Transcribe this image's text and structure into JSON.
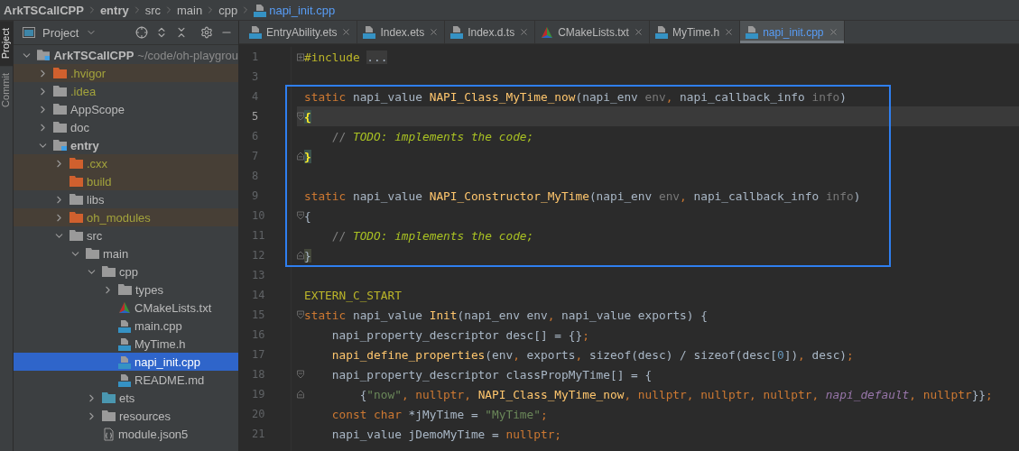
{
  "breadcrumbs": [
    {
      "label": "ArkTSCallCPP",
      "kind": "project"
    },
    {
      "label": "entry",
      "kind": "module"
    },
    {
      "label": "src",
      "kind": "dir"
    },
    {
      "label": "main",
      "kind": "dir"
    },
    {
      "label": "cpp",
      "kind": "dir"
    },
    {
      "label": "napi_init.cpp",
      "kind": "file"
    }
  ],
  "tool_strip": [
    {
      "label": "Project",
      "selected": true
    },
    {
      "label": "Commit",
      "selected": false
    }
  ],
  "project_panel": {
    "title": "Project",
    "tree": [
      {
        "label": "ArkTSCallCPP",
        "path": "~/code/oh-playgrou",
        "kind": "module",
        "expanded": true,
        "selected": false,
        "excluded": false,
        "ignored": false,
        "children": [
          {
            "label": ".hvigor",
            "kind": "folder",
            "expanded": false,
            "selected": false,
            "excluded": true,
            "ignored": true
          },
          {
            "label": ".idea",
            "kind": "folder",
            "expanded": false,
            "selected": false,
            "excluded": false,
            "ignored": true
          },
          {
            "label": "AppScope",
            "kind": "folder",
            "expanded": false,
            "selected": false,
            "excluded": false,
            "ignored": false
          },
          {
            "label": "doc",
            "kind": "folder",
            "expanded": false,
            "selected": false,
            "excluded": false,
            "ignored": false
          },
          {
            "label": "entry",
            "kind": "module",
            "expanded": true,
            "selected": false,
            "excluded": false,
            "ignored": false,
            "children": [
              {
                "label": ".cxx",
                "kind": "folder",
                "expanded": false,
                "selected": false,
                "excluded": true,
                "ignored": true
              },
              {
                "label": "build",
                "kind": "folder",
                "selected": false,
                "excluded": true,
                "ignored": true
              },
              {
                "label": "libs",
                "kind": "folder",
                "expanded": false,
                "selected": false,
                "excluded": false,
                "ignored": false
              },
              {
                "label": "oh_modules",
                "kind": "folder",
                "expanded": false,
                "selected": false,
                "excluded": true,
                "ignored": true
              },
              {
                "label": "src",
                "kind": "folder",
                "expanded": true,
                "selected": false,
                "excluded": false,
                "ignored": false,
                "children": [
                  {
                    "label": "main",
                    "kind": "folder",
                    "expanded": true,
                    "selected": false,
                    "excluded": false,
                    "ignored": false,
                    "children": [
                      {
                        "label": "cpp",
                        "kind": "folder",
                        "expanded": true,
                        "selected": false,
                        "excluded": false,
                        "ignored": false,
                        "children": [
                          {
                            "label": "types",
                            "kind": "folder",
                            "expanded": false,
                            "selected": false,
                            "excluded": false,
                            "ignored": false
                          },
                          {
                            "label": "CMakeLists.txt",
                            "kind": "cmake",
                            "selected": false,
                            "ignored": false
                          },
                          {
                            "label": "main.cpp",
                            "kind": "cpp",
                            "selected": false,
                            "ignored": false
                          },
                          {
                            "label": "MyTime.h",
                            "kind": "header",
                            "selected": false,
                            "ignored": false
                          },
                          {
                            "label": "napi_init.cpp",
                            "kind": "cpp",
                            "selected": true,
                            "ignored": false
                          },
                          {
                            "label": "README.md",
                            "kind": "markdown",
                            "selected": false,
                            "ignored": false
                          }
                        ]
                      },
                      {
                        "label": "ets",
                        "kind": "source-folder",
                        "expanded": false,
                        "selected": false,
                        "excluded": false,
                        "ignored": false
                      },
                      {
                        "label": "resources",
                        "kind": "folder",
                        "expanded": false,
                        "selected": false,
                        "excluded": false,
                        "ignored": false
                      },
                      {
                        "label": "module.json5",
                        "kind": "json",
                        "selected": false,
                        "ignored": false
                      }
                    ]
                  }
                ]
              }
            ]
          }
        ]
      }
    ]
  },
  "tabs": [
    {
      "label": "EntryAbility.ets",
      "kind": "ets",
      "selected": false
    },
    {
      "label": "Index.ets",
      "kind": "ets",
      "selected": false
    },
    {
      "label": "Index.d.ts",
      "kind": "ts",
      "selected": false
    },
    {
      "label": "CMakeLists.txt",
      "kind": "cmake",
      "selected": false
    },
    {
      "label": "MyTime.h",
      "kind": "header",
      "selected": false
    },
    {
      "label": "napi_init.cpp",
      "kind": "cpp",
      "selected": true
    }
  ],
  "editor": {
    "lines": [
      {
        "number": "1",
        "kind": "collapsed",
        "current": false,
        "highlighted": false,
        "tokens": [
          {
            "text": "#include",
            "kind": "macro"
          },
          {
            "text": "...",
            "kind": "folded"
          }
        ]
      },
      {
        "number": "3",
        "kind": "plain",
        "current": false,
        "highlighted": false
      },
      {
        "number": "4",
        "kind": "plain",
        "current": false,
        "highlighted": true,
        "tokens": [
          {
            "text": "static",
            "kind": "kw"
          },
          {
            "text": " napi_value ",
            "kind": "plain"
          },
          {
            "text": "NAPI_Class_MyTime_now",
            "kind": "fn"
          },
          {
            "text": "(napi_env ",
            "kind": "plain"
          },
          {
            "text": "env",
            "kind": "param"
          },
          {
            "text": ", ",
            "kind": "kw"
          },
          {
            "text": "napi_callback_info ",
            "kind": "plain"
          },
          {
            "text": "info",
            "kind": "param"
          },
          {
            "text": ")",
            "kind": "plain"
          }
        ]
      },
      {
        "number": "5",
        "kind": "fold-start",
        "current": true,
        "highlighted": true,
        "tokens": [
          {
            "text": "{",
            "kind": "brace"
          }
        ]
      },
      {
        "number": "6",
        "kind": "plain",
        "current": false,
        "highlighted": true,
        "tokens": [
          {
            "text": "    // ",
            "kind": "cmt"
          },
          {
            "text": "TODO: implements the code;",
            "kind": "todo"
          }
        ]
      },
      {
        "number": "7",
        "kind": "fold-end",
        "current": false,
        "highlighted": true,
        "tokens": [
          {
            "text": "}",
            "kind": "brace"
          }
        ]
      },
      {
        "number": "8",
        "kind": "plain",
        "current": false,
        "highlighted": true
      },
      {
        "number": "9",
        "kind": "plain",
        "current": false,
        "highlighted": true,
        "tokens": [
          {
            "text": "static",
            "kind": "kw"
          },
          {
            "text": " napi_value ",
            "kind": "plain"
          },
          {
            "text": "NAPI_Constructor_MyTime",
            "kind": "fn"
          },
          {
            "text": "(napi_env ",
            "kind": "plain"
          },
          {
            "text": "env",
            "kind": "param"
          },
          {
            "text": ", ",
            "kind": "kw"
          },
          {
            "text": "napi_callback_info ",
            "kind": "plain"
          },
          {
            "text": "info",
            "kind": "param"
          },
          {
            "text": ")",
            "kind": "plain"
          }
        ]
      },
      {
        "number": "10",
        "kind": "fold-start",
        "current": false,
        "highlighted": true,
        "tokens": [
          {
            "text": "{",
            "kind": "plain"
          }
        ]
      },
      {
        "number": "11",
        "kind": "plain",
        "current": false,
        "highlighted": true,
        "tokens": [
          {
            "text": "    // ",
            "kind": "cmt"
          },
          {
            "text": "TODO: implements the code;",
            "kind": "todo"
          }
        ]
      },
      {
        "number": "12",
        "kind": "fold-end",
        "current": false,
        "highlighted": true,
        "tokens": [
          {
            "text": "}",
            "kind": "brace-dim"
          }
        ]
      },
      {
        "number": "13",
        "kind": "plain",
        "current": false,
        "highlighted": false
      },
      {
        "number": "14",
        "kind": "plain",
        "current": false,
        "highlighted": false,
        "tokens": [
          {
            "text": "EXTERN_C_START",
            "kind": "macro"
          }
        ]
      },
      {
        "number": "15",
        "kind": "fold-start",
        "current": false,
        "highlighted": false,
        "tokens": [
          {
            "text": "static",
            "kind": "kw"
          },
          {
            "text": " napi_value ",
            "kind": "plain"
          },
          {
            "text": "Init",
            "kind": "fn"
          },
          {
            "text": "(napi_env env",
            "kind": "plain"
          },
          {
            "text": ", ",
            "kind": "kw"
          },
          {
            "text": "napi_value exports) {",
            "kind": "plain"
          }
        ]
      },
      {
        "number": "16",
        "kind": "plain",
        "current": false,
        "highlighted": false,
        "tokens": [
          {
            "text": "    napi_property_descriptor desc[] = {}",
            "kind": "plain"
          },
          {
            "text": ";",
            "kind": "kw"
          }
        ]
      },
      {
        "number": "17",
        "kind": "plain",
        "current": false,
        "highlighted": false,
        "tokens": [
          {
            "text": "    napi_define_properties",
            "kind": "fn"
          },
          {
            "text": "(env",
            "kind": "plain"
          },
          {
            "text": ", ",
            "kind": "kw"
          },
          {
            "text": "exports",
            "kind": "plain"
          },
          {
            "text": ", ",
            "kind": "kw"
          },
          {
            "text": "sizeof(desc) / sizeof(desc[",
            "kind": "plain"
          },
          {
            "text": "0",
            "kind": "num"
          },
          {
            "text": "])",
            "kind": "plain"
          },
          {
            "text": ", ",
            "kind": "kw"
          },
          {
            "text": "desc)",
            "kind": "plain"
          },
          {
            "text": ";",
            "kind": "kw"
          }
        ]
      },
      {
        "number": "18",
        "kind": "fold-start",
        "current": false,
        "highlighted": false,
        "tokens": [
          {
            "text": "    napi_property_descriptor classPropMyTime[] = {",
            "kind": "plain"
          }
        ]
      },
      {
        "number": "19",
        "kind": "fold-end",
        "current": false,
        "highlighted": false,
        "tokens": [
          {
            "text": "        {",
            "kind": "plain"
          },
          {
            "text": "\"now\"",
            "kind": "str"
          },
          {
            "text": ", nullptr, ",
            "kind": "kw"
          },
          {
            "text": "NAPI_Class_MyTime_now",
            "kind": "fn"
          },
          {
            "text": ", nullptr, nullptr, nullptr, ",
            "kind": "kw"
          },
          {
            "text": "napi_default",
            "kind": "const"
          },
          {
            "text": ", nullptr",
            "kind": "kw"
          },
          {
            "text": "}}",
            "kind": "plain"
          },
          {
            "text": ";",
            "kind": "kw"
          }
        ]
      },
      {
        "number": "20",
        "kind": "plain",
        "current": false,
        "highlighted": false,
        "tokens": [
          {
            "text": "    const char ",
            "kind": "kw"
          },
          {
            "text": "*jMyTime = ",
            "kind": "plain"
          },
          {
            "text": "\"MyTime\"",
            "kind": "str"
          },
          {
            "text": ";",
            "kind": "kw"
          }
        ]
      },
      {
        "number": "21",
        "kind": "plain",
        "current": false,
        "highlighted": false,
        "tokens": [
          {
            "text": "    napi_value jDemoMyTime = ",
            "kind": "plain"
          },
          {
            "text": "nullptr;",
            "kind": "kw"
          }
        ]
      }
    ]
  }
}
